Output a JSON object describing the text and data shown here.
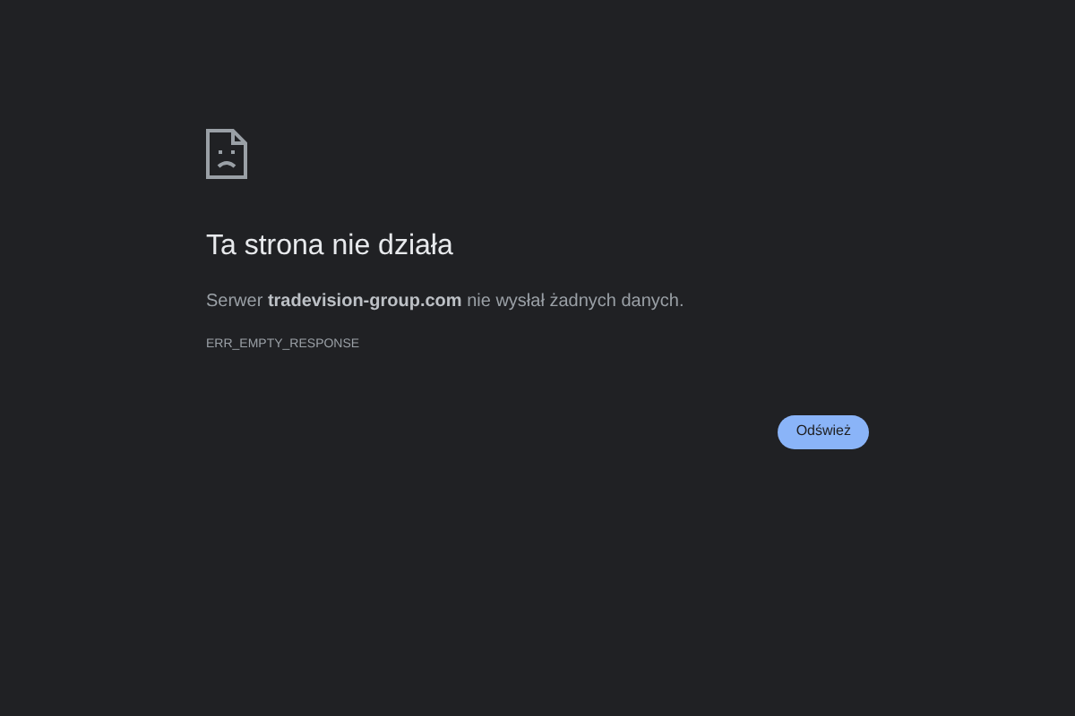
{
  "error": {
    "title": "Ta strona nie działa",
    "message": "Serwer **tradevision-group.com** nie wysłał żadnych danych.",
    "code": "ERR_EMPTY_RESPONSE"
  },
  "buttons": [
    "Odśwież"
  ]
}
